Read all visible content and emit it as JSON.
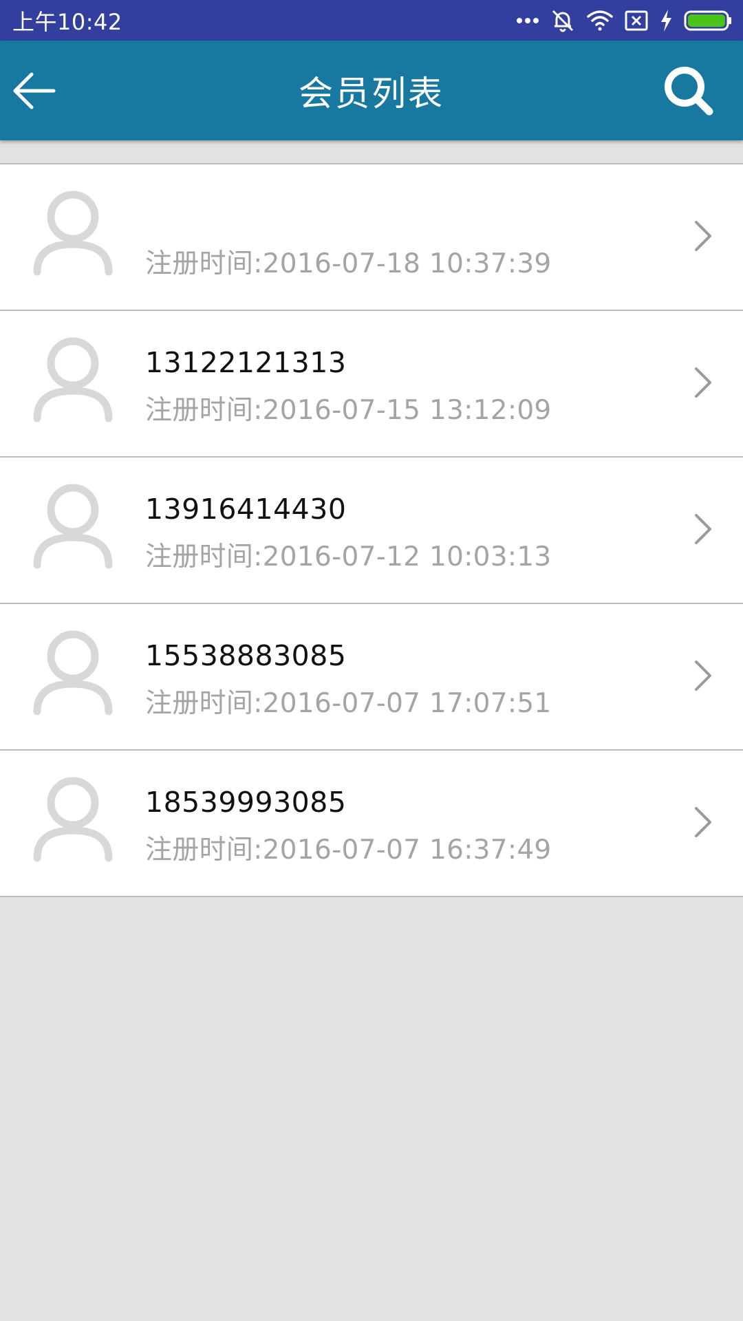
{
  "status_bar": {
    "time": "上午10:42",
    "icons": [
      "more-dots-icon",
      "silent-bell-icon",
      "wifi-icon",
      "no-sim-icon",
      "charging-icon",
      "battery-icon"
    ],
    "battery_color": "#4cc417"
  },
  "header": {
    "title": "会员列表",
    "back_icon": "arrow-left-icon",
    "search_icon": "search-icon",
    "background": "#17799f"
  },
  "members": [
    {
      "phone": "",
      "registered": "注册时间:2016-07-18 10:37:39"
    },
    {
      "phone": "13122121313",
      "registered": "注册时间:2016-07-15 13:12:09"
    },
    {
      "phone": "13916414430",
      "registered": "注册时间:2016-07-12 10:03:13"
    },
    {
      "phone": "15538883085",
      "registered": "注册时间:2016-07-07 17:07:51"
    },
    {
      "phone": "18539993085",
      "registered": "注册时间:2016-07-07 16:37:49"
    }
  ]
}
